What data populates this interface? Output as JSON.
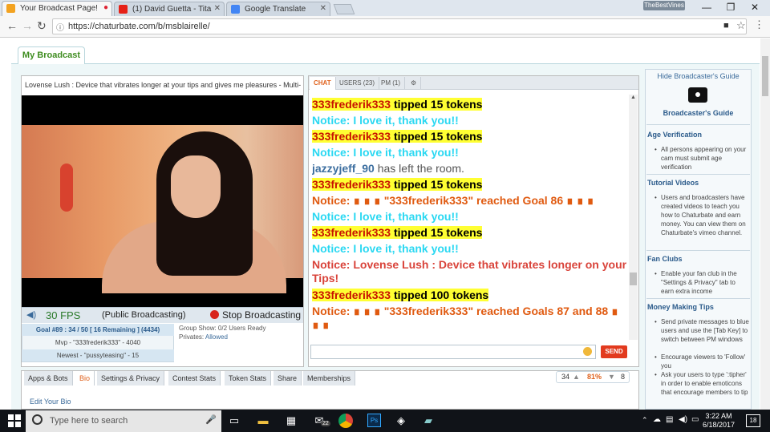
{
  "browser": {
    "tabs": [
      {
        "title": "Your Broadcast Page!",
        "favicon_color": "#f3a321"
      },
      {
        "title": "(1) David Guetta - Tita",
        "favicon_color": "#e62117"
      },
      {
        "title": "Google Translate",
        "favicon_color": "#4285f4"
      }
    ],
    "profile": "TheBestVines",
    "url": "https://chaturbate.com/b/msblairelle/",
    "window_controls": {
      "minimize": "—",
      "maximize": "❐",
      "close": "✕"
    }
  },
  "page": {
    "tab_label": "My Broadcast",
    "video_title": "Lovense Lush : Device that vibrates longer at your tips and gives me pleasures - Multi-",
    "fps": "30 FPS",
    "broadcast_status": "(Public Broadcasting)",
    "stop_label": "Stop Broadcasting",
    "goal": "Goal #89 : 34 / 50 [ 16 Remaining ] (4434)",
    "mvp": "Mvp - \"333frederik333\" - 4040",
    "newest": "Newest - \"pussyteasing\" - 15",
    "group_show": "Group Show: 0/2 Users Ready",
    "privates_label": "Privates:",
    "privates_value": "Allowed"
  },
  "chat": {
    "tabs": [
      "CHAT",
      "USERS (23)",
      "PM (1)",
      "⚙"
    ],
    "messages": [
      {
        "type": "tip",
        "user": "333frederik333",
        "text": " tipped 15 tokens"
      },
      {
        "type": "thanks",
        "text": "Notice: I love it, thank you!!"
      },
      {
        "type": "tip",
        "user": "333frederik333",
        "text": " tipped 15 tokens"
      },
      {
        "type": "thanks",
        "text": "Notice: I love it, thank you!!"
      },
      {
        "type": "left",
        "user": "jazzyjeff_90",
        "text": " has left the room."
      },
      {
        "type": "tip",
        "user": "333frederik333",
        "text": " tipped 15 tokens"
      },
      {
        "type": "goal",
        "text": "Notice: ∎ ∎ ∎ \"333frederik333\" reached Goal 86 ∎ ∎ ∎"
      },
      {
        "type": "thanks",
        "text": "Notice: I love it, thank you!!"
      },
      {
        "type": "tip",
        "user": "333frederik333",
        "text": " tipped 15 tokens"
      },
      {
        "type": "thanks",
        "text": "Notice: I love it, thank you!!"
      },
      {
        "type": "lovense",
        "text": "Notice: Lovense Lush : Device that vibrates longer on your Tips!"
      },
      {
        "type": "tip",
        "user": "333frederik333",
        "text": " tipped 100 tokens"
      },
      {
        "type": "goal",
        "text": "Notice: ∎ ∎ ∎ \"333frederik333\" reached Goals 87 and 88 ∎ ∎ ∎"
      }
    ],
    "send_label": "SEND"
  },
  "guide": {
    "hide_label": "Hide Broadcaster's Guide",
    "title": "Broadcaster's Guide",
    "sections": [
      {
        "heading": "Age Verification",
        "bullets": [
          "All persons appearing on your cam must submit age verification"
        ]
      },
      {
        "heading": "Tutorial Videos",
        "bullets": [
          "Users and broadcasters have created videos to teach you how to Chaturbate and earn money. You can view them on Chaturbate's vimeo channel."
        ]
      },
      {
        "heading": "Fan Clubs",
        "bullets": [
          "Enable your fan club in the \"Settings & Privacy\" tab to earn extra income"
        ]
      },
      {
        "heading": "Money Making Tips",
        "bullets": [
          "Send private messages to blue users and use the [Tab Key] to switch between PM windows",
          "Encourage viewers to 'Follow' you",
          "Ask your users to type ':tipher' in order to enable emoticons that encourage members to tip"
        ]
      }
    ]
  },
  "bottom": {
    "tabs": [
      "Apps & Bots",
      "Bio",
      "Settings & Privacy",
      "Contest Stats",
      "Token Stats",
      "Share",
      "Memberships"
    ],
    "active_tab": "Bio",
    "edit_bio": "Edit Your Bio",
    "votes_up": "34",
    "satisfaction": "81%",
    "votes_down": "8"
  },
  "taskbar": {
    "search_placeholder": "Type here to search",
    "time": "3:22 AM",
    "date": "6/18/2017",
    "notifications": "18",
    "mail_count": "22"
  }
}
